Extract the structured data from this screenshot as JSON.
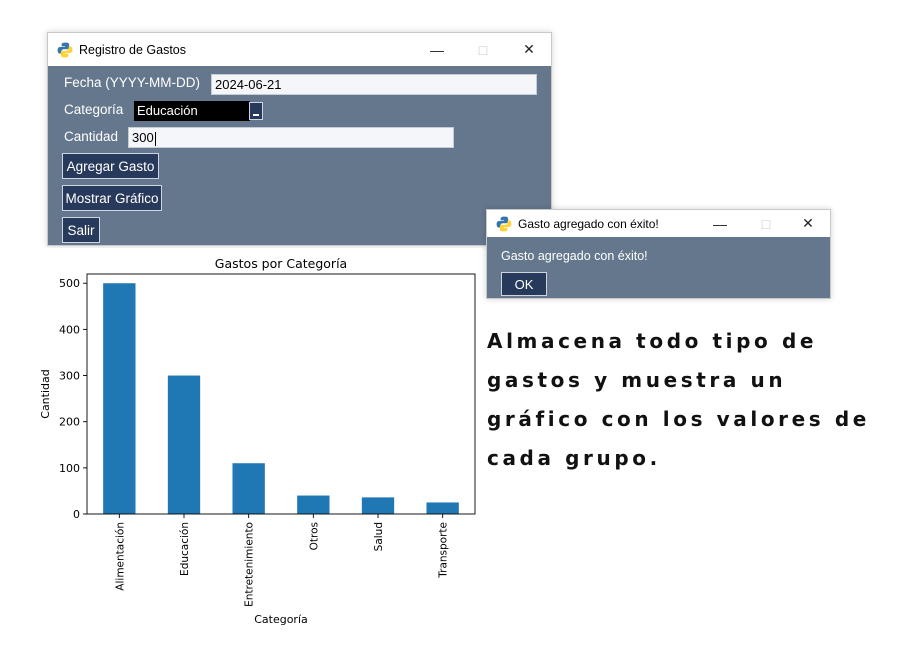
{
  "main_window": {
    "title": "Registro de Gastos",
    "controls": {
      "minimize": "—",
      "maximize": "□",
      "close": "✕"
    },
    "fecha_label": "Fecha (YYYY-MM-DD)",
    "fecha_value": "2024-06-21",
    "categoria_label": "Categoría",
    "categoria_selected": "Educación",
    "cantidad_label": "Cantidad",
    "cantidad_value": "300",
    "add_button": "Agregar Gasto",
    "chart_button": "Mostrar Gráfico",
    "exit_button": "Salir",
    "icon": "python-icon",
    "colors": {
      "client_bg": "#64778d",
      "button_bg": "#283a5c",
      "entry_bg": "#f4f6f9"
    }
  },
  "popup": {
    "title": "Gasto agregado con éxito!",
    "message": "Gasto agregado con éxito!",
    "ok_button": "OK",
    "controls": {
      "minimize": "—",
      "maximize": "□",
      "close": "✕"
    }
  },
  "chart_data": {
    "type": "bar",
    "title": "Gastos por Categoría",
    "xlabel": "Categoría",
    "ylabel": "Cantidad",
    "categories": [
      "Alimentación",
      "Educación",
      "Entretenimiento",
      "Otros",
      "Salud",
      "Transporte"
    ],
    "values": [
      500,
      300,
      110,
      40,
      36,
      25
    ],
    "ylim": [
      0,
      520
    ],
    "yticks": [
      0,
      100,
      200,
      300,
      400,
      500
    ],
    "bar_color": "#1f77b4",
    "grid": false
  },
  "caption": {
    "lines": [
      "Almacena todo tipo de",
      "gastos y muestra un",
      "gráfico con los valores de",
      "cada grupo."
    ]
  }
}
